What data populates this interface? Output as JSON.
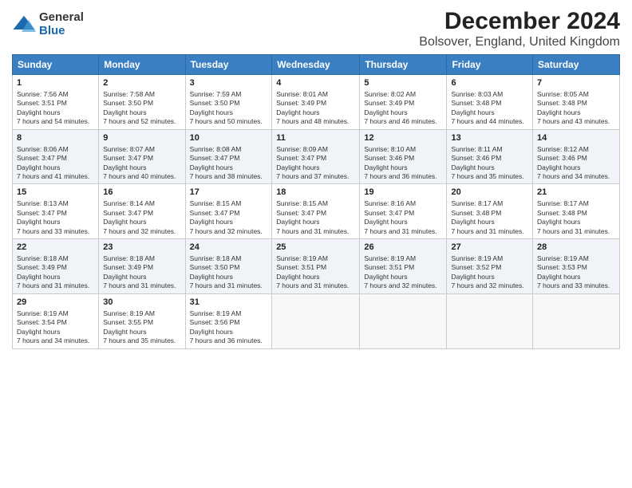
{
  "header": {
    "logo": {
      "general": "General",
      "blue": "Blue"
    },
    "title": "December 2024",
    "subtitle": "Bolsover, England, United Kingdom"
  },
  "weekdays": [
    "Sunday",
    "Monday",
    "Tuesday",
    "Wednesday",
    "Thursday",
    "Friday",
    "Saturday"
  ],
  "weeks": [
    [
      {
        "day": "1",
        "sunrise": "7:56 AM",
        "sunset": "3:51 PM",
        "daylight": "7 hours and 54 minutes."
      },
      {
        "day": "2",
        "sunrise": "7:58 AM",
        "sunset": "3:50 PM",
        "daylight": "7 hours and 52 minutes."
      },
      {
        "day": "3",
        "sunrise": "7:59 AM",
        "sunset": "3:50 PM",
        "daylight": "7 hours and 50 minutes."
      },
      {
        "day": "4",
        "sunrise": "8:01 AM",
        "sunset": "3:49 PM",
        "daylight": "7 hours and 48 minutes."
      },
      {
        "day": "5",
        "sunrise": "8:02 AM",
        "sunset": "3:49 PM",
        "daylight": "7 hours and 46 minutes."
      },
      {
        "day": "6",
        "sunrise": "8:03 AM",
        "sunset": "3:48 PM",
        "daylight": "7 hours and 44 minutes."
      },
      {
        "day": "7",
        "sunrise": "8:05 AM",
        "sunset": "3:48 PM",
        "daylight": "7 hours and 43 minutes."
      }
    ],
    [
      {
        "day": "8",
        "sunrise": "8:06 AM",
        "sunset": "3:47 PM",
        "daylight": "7 hours and 41 minutes."
      },
      {
        "day": "9",
        "sunrise": "8:07 AM",
        "sunset": "3:47 PM",
        "daylight": "7 hours and 40 minutes."
      },
      {
        "day": "10",
        "sunrise": "8:08 AM",
        "sunset": "3:47 PM",
        "daylight": "7 hours and 38 minutes."
      },
      {
        "day": "11",
        "sunrise": "8:09 AM",
        "sunset": "3:47 PM",
        "daylight": "7 hours and 37 minutes."
      },
      {
        "day": "12",
        "sunrise": "8:10 AM",
        "sunset": "3:46 PM",
        "daylight": "7 hours and 36 minutes."
      },
      {
        "day": "13",
        "sunrise": "8:11 AM",
        "sunset": "3:46 PM",
        "daylight": "7 hours and 35 minutes."
      },
      {
        "day": "14",
        "sunrise": "8:12 AM",
        "sunset": "3:46 PM",
        "daylight": "7 hours and 34 minutes."
      }
    ],
    [
      {
        "day": "15",
        "sunrise": "8:13 AM",
        "sunset": "3:47 PM",
        "daylight": "7 hours and 33 minutes."
      },
      {
        "day": "16",
        "sunrise": "8:14 AM",
        "sunset": "3:47 PM",
        "daylight": "7 hours and 32 minutes."
      },
      {
        "day": "17",
        "sunrise": "8:15 AM",
        "sunset": "3:47 PM",
        "daylight": "7 hours and 32 minutes."
      },
      {
        "day": "18",
        "sunrise": "8:15 AM",
        "sunset": "3:47 PM",
        "daylight": "7 hours and 31 minutes."
      },
      {
        "day": "19",
        "sunrise": "8:16 AM",
        "sunset": "3:47 PM",
        "daylight": "7 hours and 31 minutes."
      },
      {
        "day": "20",
        "sunrise": "8:17 AM",
        "sunset": "3:48 PM",
        "daylight": "7 hours and 31 minutes."
      },
      {
        "day": "21",
        "sunrise": "8:17 AM",
        "sunset": "3:48 PM",
        "daylight": "7 hours and 31 minutes."
      }
    ],
    [
      {
        "day": "22",
        "sunrise": "8:18 AM",
        "sunset": "3:49 PM",
        "daylight": "7 hours and 31 minutes."
      },
      {
        "day": "23",
        "sunrise": "8:18 AM",
        "sunset": "3:49 PM",
        "daylight": "7 hours and 31 minutes."
      },
      {
        "day": "24",
        "sunrise": "8:18 AM",
        "sunset": "3:50 PM",
        "daylight": "7 hours and 31 minutes."
      },
      {
        "day": "25",
        "sunrise": "8:19 AM",
        "sunset": "3:51 PM",
        "daylight": "7 hours and 31 minutes."
      },
      {
        "day": "26",
        "sunrise": "8:19 AM",
        "sunset": "3:51 PM",
        "daylight": "7 hours and 32 minutes."
      },
      {
        "day": "27",
        "sunrise": "8:19 AM",
        "sunset": "3:52 PM",
        "daylight": "7 hours and 32 minutes."
      },
      {
        "day": "28",
        "sunrise": "8:19 AM",
        "sunset": "3:53 PM",
        "daylight": "7 hours and 33 minutes."
      }
    ],
    [
      {
        "day": "29",
        "sunrise": "8:19 AM",
        "sunset": "3:54 PM",
        "daylight": "7 hours and 34 minutes."
      },
      {
        "day": "30",
        "sunrise": "8:19 AM",
        "sunset": "3:55 PM",
        "daylight": "7 hours and 35 minutes."
      },
      {
        "day": "31",
        "sunrise": "8:19 AM",
        "sunset": "3:56 PM",
        "daylight": "7 hours and 36 minutes."
      },
      null,
      null,
      null,
      null
    ]
  ],
  "labels": {
    "sunrise": "Sunrise:",
    "sunset": "Sunset:",
    "daylight": "Daylight hours"
  }
}
